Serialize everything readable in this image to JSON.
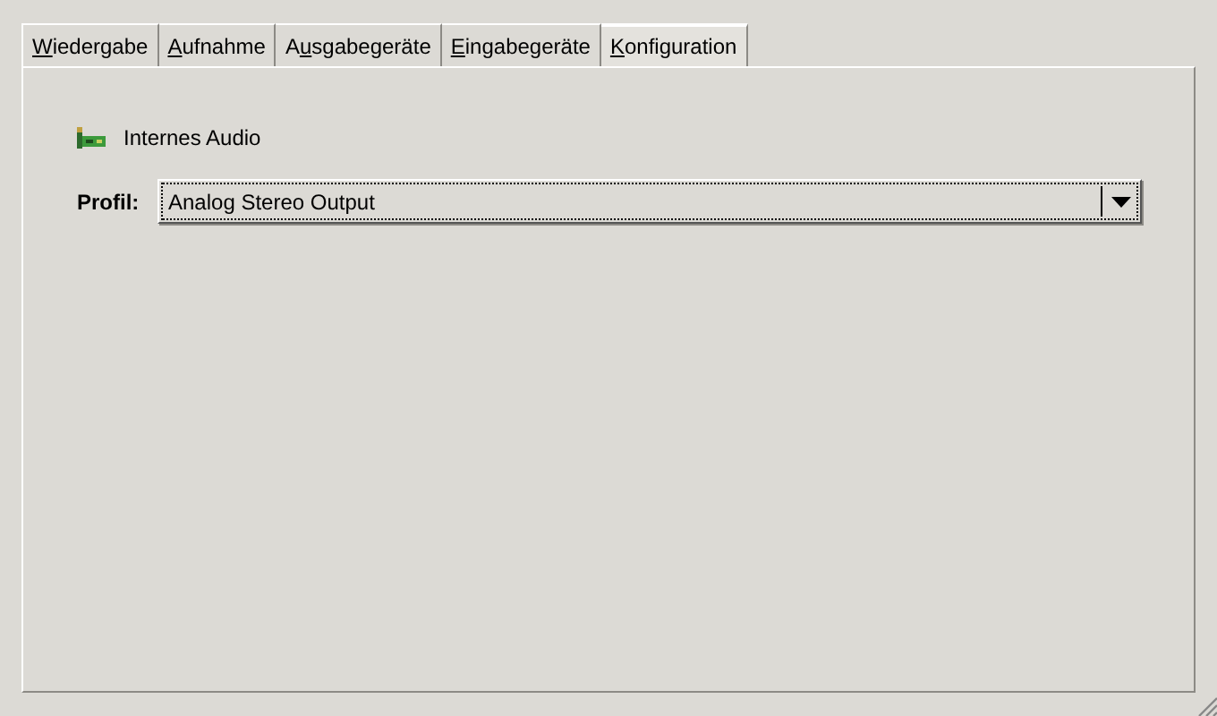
{
  "tabs": [
    {
      "mnemonic": "W",
      "after": "iedergabe",
      "selected": false
    },
    {
      "mnemonic": "A",
      "after": "ufnahme",
      "selected": false
    },
    {
      "before": "A",
      "mnemonic": "u",
      "after": "sgabegeräte",
      "selected": false
    },
    {
      "mnemonic": "E",
      "after": "ingabegeräte",
      "selected": false
    },
    {
      "mnemonic": "K",
      "after": "onfiguration",
      "selected": true
    }
  ],
  "device": {
    "name": "Internes Audio"
  },
  "profile": {
    "label": "Profil:",
    "value": "Analog Stereo Output"
  }
}
